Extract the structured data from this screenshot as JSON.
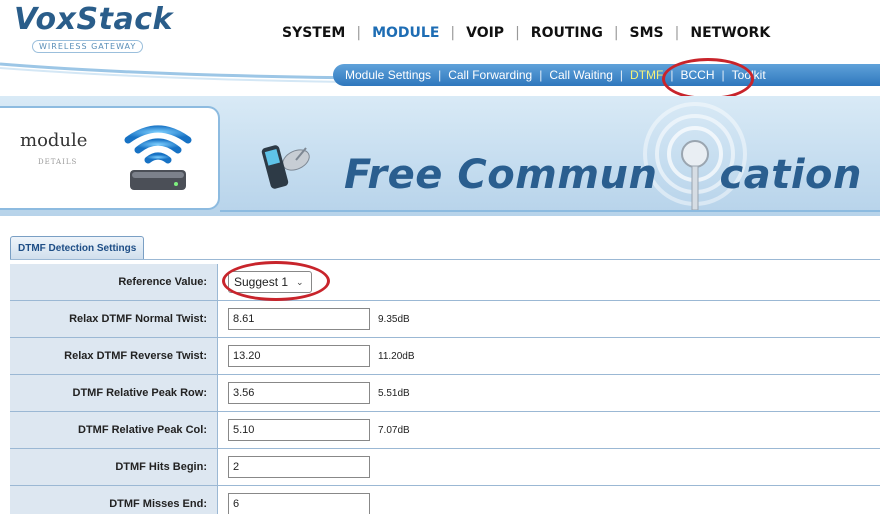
{
  "brand": {
    "name": "VoxStack",
    "tagline": "WIRELESS GATEWAY"
  },
  "top_nav": [
    {
      "label": "SYSTEM",
      "active": false
    },
    {
      "label": "MODULE",
      "active": true
    },
    {
      "label": "VOIP",
      "active": false
    },
    {
      "label": "ROUTING",
      "active": false
    },
    {
      "label": "SMS",
      "active": false
    },
    {
      "label": "NETWORK",
      "active": false
    }
  ],
  "sub_nav": [
    {
      "label": "Module Settings",
      "active": false
    },
    {
      "label": "Call Forwarding",
      "active": false
    },
    {
      "label": "Call Waiting",
      "active": false
    },
    {
      "label": "DTMF",
      "active": true
    },
    {
      "label": "BCCH",
      "active": false
    },
    {
      "label": "Toolkit",
      "active": false
    }
  ],
  "banner": {
    "card_title": "module",
    "card_subtitle": "DETAILS",
    "headline_left": "Free Commun",
    "headline_right": "cation"
  },
  "section": {
    "title": "DTMF Detection Settings"
  },
  "form": {
    "reference": {
      "label": "Reference Value:",
      "selected": "Suggest 1"
    },
    "rows": [
      {
        "label": "Relax DTMF Normal Twist:",
        "value": "8.61",
        "unit": "9.35dB"
      },
      {
        "label": "Relax DTMF Reverse Twist:",
        "value": "13.20",
        "unit": "11.20dB"
      },
      {
        "label": "DTMF Relative Peak Row:",
        "value": "3.56",
        "unit": "5.51dB"
      },
      {
        "label": "DTMF Relative Peak Col:",
        "value": "5.10",
        "unit": "7.07dB"
      },
      {
        "label": "DTMF Hits Begin:",
        "value": "2",
        "unit": ""
      },
      {
        "label": "DTMF Misses End:",
        "value": "6",
        "unit": ""
      }
    ]
  },
  "colors": {
    "accent": "#1e6db4",
    "highlight_oval": "#c8242b",
    "subnav_active": "#f4f27a"
  }
}
